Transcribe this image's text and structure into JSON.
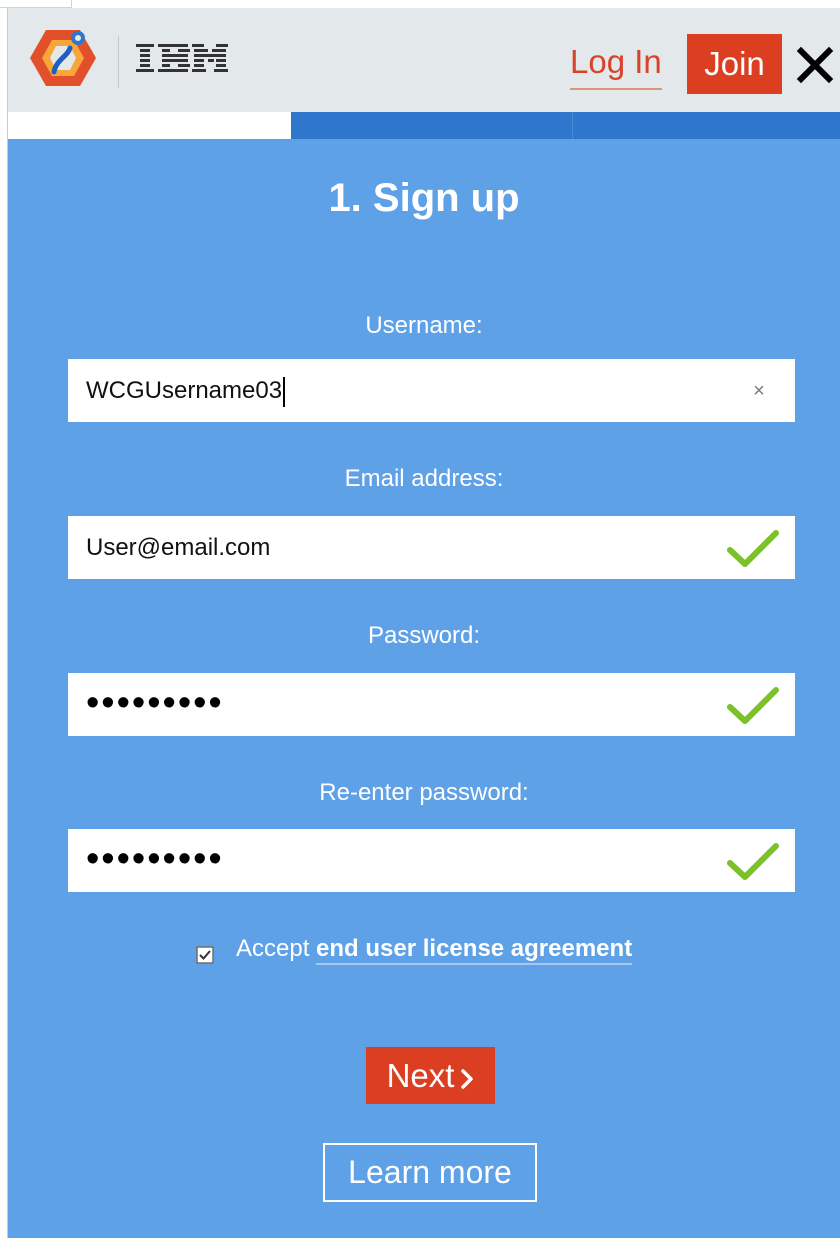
{
  "header": {
    "brand": "IBM",
    "login_label": "Log In",
    "join_label": "Join",
    "close_icon": "close-icon"
  },
  "progress": {
    "steps": 3,
    "current_step": 1
  },
  "form": {
    "title": "1. Sign up",
    "username": {
      "label": "Username:",
      "value": "WCGUsername03",
      "clear_glyph": "×"
    },
    "email": {
      "label": "Email address:",
      "value": "User@email.com",
      "status_icon": "checkmark-icon"
    },
    "password": {
      "label": "Password:",
      "value": "•••••••••",
      "status_icon": "checkmark-icon"
    },
    "reenter_password": {
      "label": "Re-enter password:",
      "value": "•••••••••",
      "status_icon": "checkmark-icon"
    },
    "accept": {
      "prefix": "Accept",
      "link": "end user license agreement",
      "checked": true
    },
    "next_label": "Next",
    "learn_more_label": "Learn more"
  },
  "colors": {
    "panel_background": "#5ea1e6",
    "accent": "#db3e20",
    "valid": "#7ac12a",
    "progress_active": "#ffffff",
    "progress_track": "#2f77cd"
  }
}
